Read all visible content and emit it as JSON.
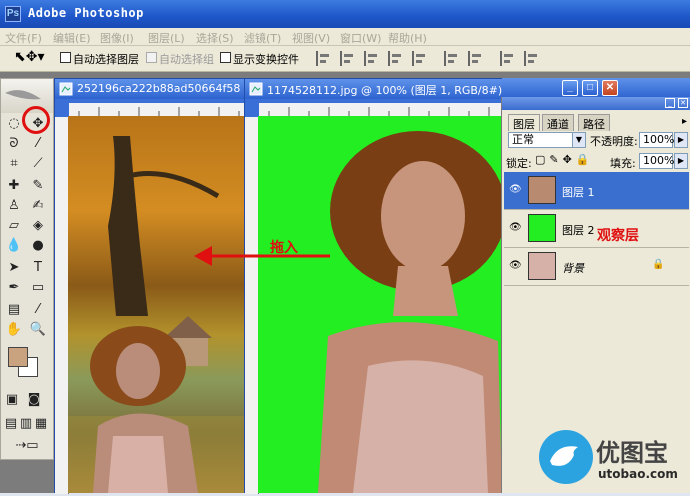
{
  "app": {
    "title": "Adobe Photoshop"
  },
  "menu": [
    "文件(F)",
    "编辑(E)",
    "图像(I)",
    "图层(L)",
    "选择(S)",
    "滤镜(T)",
    "视图(V)",
    "窗口(W)",
    "帮助(H)"
  ],
  "options": {
    "auto_select_layer": "自动选择图层",
    "auto_select_group": "自动选择组",
    "show_transform": "显示变换控件"
  },
  "documents": [
    {
      "title": "252196ca222b88ad50664f58"
    },
    {
      "title": "1174528112.jpg @ 100% (图层 1, RGB/8#)"
    }
  ],
  "annotations": {
    "drag_in": "拖入",
    "observe_layer": "观察层"
  },
  "layers_panel": {
    "tabs": [
      "图层",
      "通道",
      "路径"
    ],
    "blend_mode": "正常",
    "opacity_label": "不透明度:",
    "opacity_value": "100%",
    "lock_label": "锁定:",
    "fill_label": "填充:",
    "fill_value": "100%",
    "layers": [
      {
        "name": "图层 1",
        "active": true
      },
      {
        "name": "图层 2",
        "active": false
      },
      {
        "name": "背景",
        "active": false
      }
    ]
  },
  "watermark": {
    "brand": "优图宝",
    "url": "utobao.com"
  },
  "colors": {
    "foreground": "#c9a37f",
    "background": "#ffffff",
    "green_layer": "#22ee22",
    "annotation_red": "#e01010"
  }
}
